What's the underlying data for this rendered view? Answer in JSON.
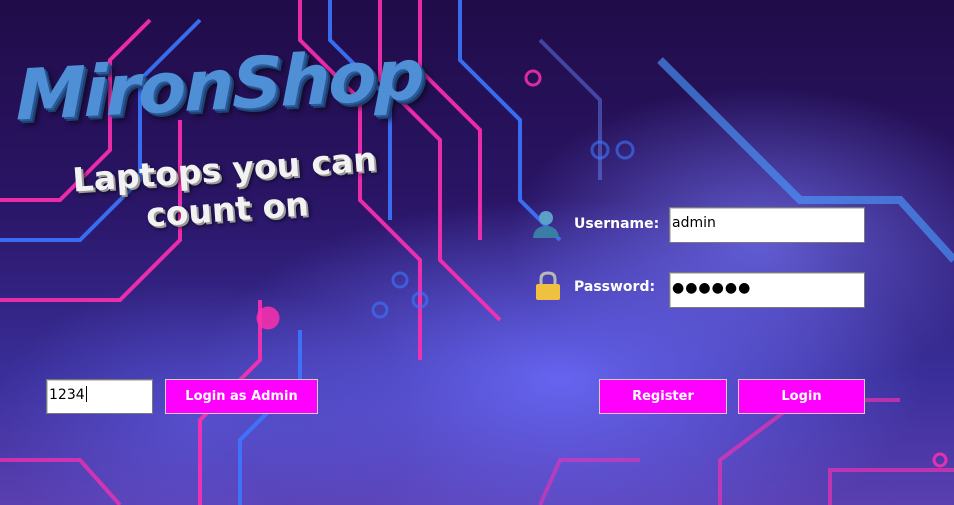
{
  "app": {
    "title": "MironShop",
    "tagline": "Laptops you can count on"
  },
  "login_form": {
    "username_label": "Username:",
    "username_value": "admin",
    "password_label": "Password:",
    "password_value": "●●●●●●",
    "username_icon": "user-icon",
    "password_icon": "lock-icon"
  },
  "admin": {
    "code_value": "1234",
    "login_as_admin_label": "Login as Admin"
  },
  "actions": {
    "register_label": "Register",
    "login_label": "Login"
  },
  "colors": {
    "button_bg": "#ff00ff",
    "title_color": "#4f8fd6",
    "background": "#2a1566"
  }
}
